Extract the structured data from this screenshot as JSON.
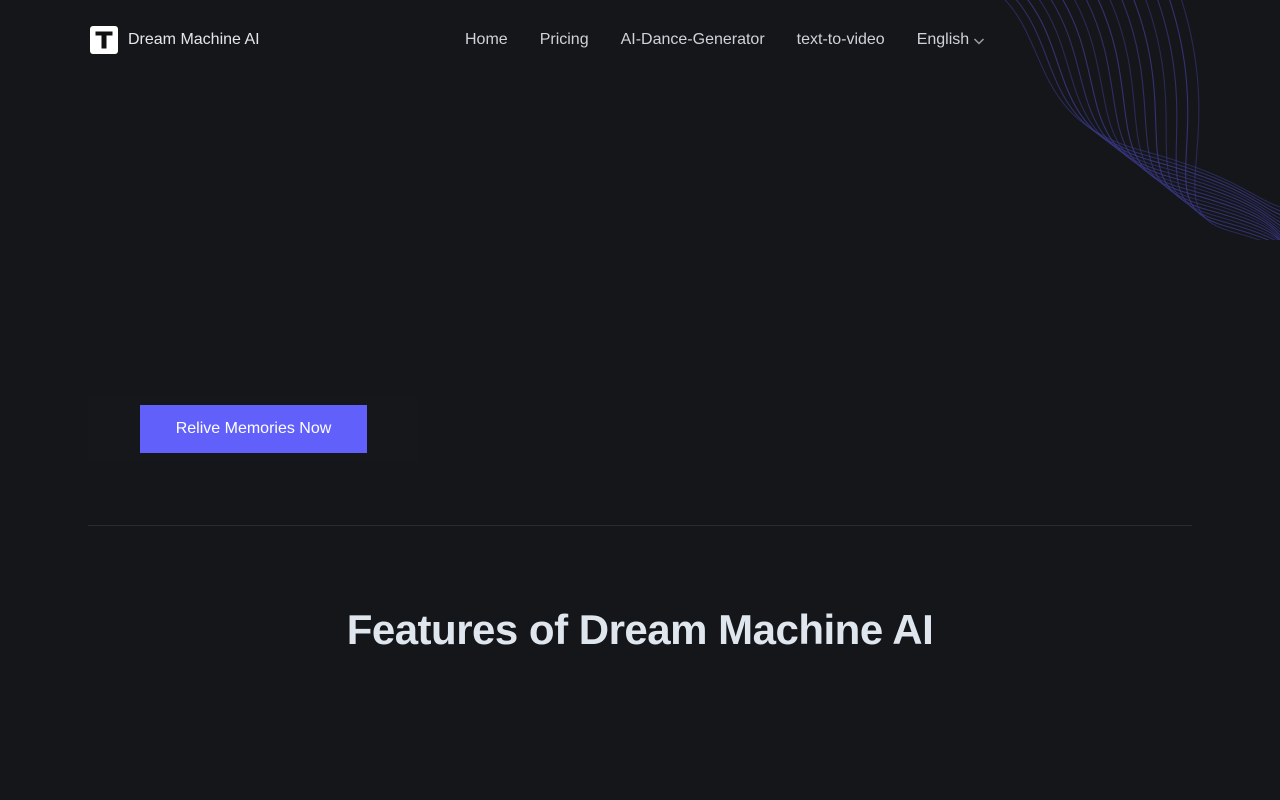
{
  "header": {
    "brand": {
      "name": "Dream Machine AI",
      "logo_letter": "T",
      "logo_icon": "t-logo-icon"
    },
    "nav": {
      "items": [
        {
          "label": "Home"
        },
        {
          "label": "Pricing"
        },
        {
          "label": "AI-Dance-Generator"
        },
        {
          "label": "text-to-video"
        }
      ],
      "language": {
        "selected": "English",
        "icon": "chevron-down-icon"
      }
    }
  },
  "hero": {
    "cta_label": "Relive Memories Now"
  },
  "features": {
    "title": "Features of Dream Machine AI"
  },
  "colors": {
    "background": "#151619",
    "accent": "#6160fb",
    "wave_lines": "#3b3a8a",
    "title": "#dfe6ee"
  }
}
